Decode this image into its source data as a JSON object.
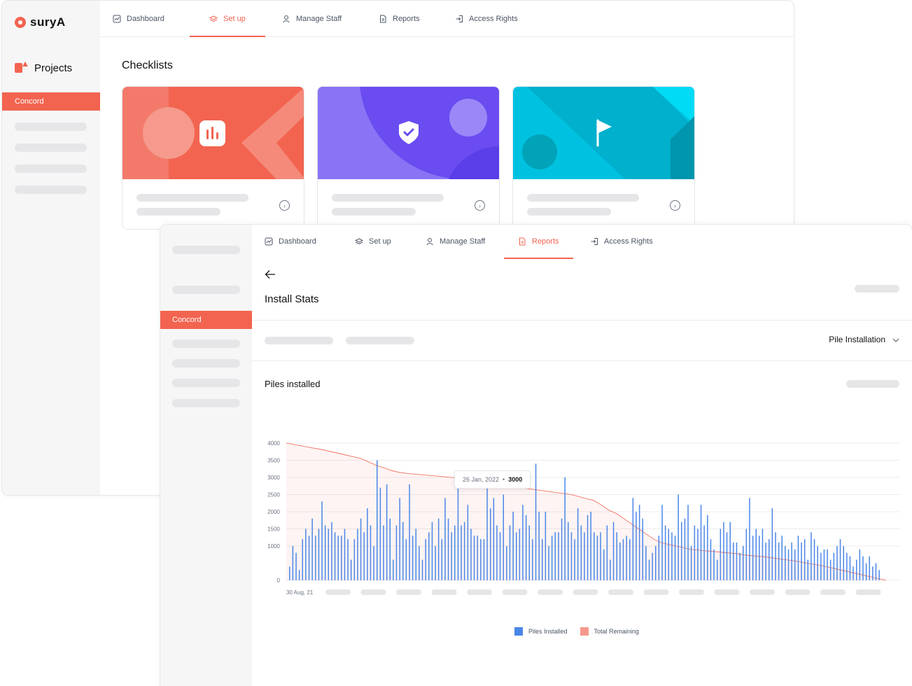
{
  "brand": {
    "name": "suryA"
  },
  "colors": {
    "accent": "#f26450",
    "bar": "#4a86e8",
    "line": "#f26450",
    "card1": "#f26450",
    "card2": "#6a4cf0",
    "card3": "#00c2e0"
  },
  "nav": {
    "items": [
      {
        "label": "Dashboard",
        "icon": "dashboard-icon"
      },
      {
        "label": "Set up",
        "icon": "layers-icon"
      },
      {
        "label": "Manage Staff",
        "icon": "user-icon"
      },
      {
        "label": "Reports",
        "icon": "document-icon"
      },
      {
        "label": "Access Rights",
        "icon": "login-icon"
      }
    ]
  },
  "back_window": {
    "sidebar": {
      "projects_label": "Projects",
      "active_project": "Concord"
    },
    "active_tab": "Set up",
    "section_title": "Checklists",
    "cards": [
      {
        "icon": "bar-chart-icon"
      },
      {
        "icon": "shield-check-icon"
      },
      {
        "icon": "flag-icon"
      }
    ]
  },
  "front_window": {
    "sidebar": {
      "active_project": "Concord"
    },
    "active_tab": "Reports",
    "page_title": "Install Stats",
    "dropdown": {
      "value": "Pile Installation"
    },
    "chart_title": "Piles installed",
    "tooltip": {
      "date": "26 Jan, 2022",
      "value": "3000"
    }
  },
  "chart_data": {
    "type": "bar",
    "title": "Piles installed",
    "xlabel": "",
    "ylabel": "",
    "ylim": [
      0,
      4000
    ],
    "yticks": [
      0,
      1000,
      1500,
      2000,
      2500,
      3000,
      3500,
      4000
    ],
    "x_first_label": "30 Aug, 21",
    "grid": true,
    "legend": "bottom-center",
    "series": [
      {
        "name": "Piles Installed",
        "type": "bar",
        "values": [
          400,
          1000,
          800,
          300,
          1200,
          1500,
          1300,
          1800,
          1300,
          1500,
          2300,
          1600,
          1500,
          1700,
          1400,
          1300,
          1300,
          1500,
          1200,
          600,
          1200,
          1500,
          1800,
          1400,
          2100,
          1600,
          1000,
          3500,
          2700,
          1600,
          2800,
          1800,
          600,
          1600,
          2400,
          1700,
          1200,
          2800,
          1300,
          1500,
          1000,
          600,
          1200,
          1400,
          1700,
          1000,
          1800,
          1200,
          2400,
          1800,
          1400,
          1600,
          2900,
          1600,
          1700,
          2200,
          1500,
          1300,
          1300,
          1200,
          1200,
          2700,
          2100,
          2400,
          1600,
          1400,
          2500,
          1000,
          1600,
          2000,
          1400,
          1500,
          2200,
          1900,
          1600,
          1200,
          3400,
          2000,
          1200,
          2000,
          1000,
          1300,
          1400,
          1400,
          1800,
          3000,
          1700,
          1400,
          1200,
          2100,
          1600,
          1400,
          1900,
          2000,
          1400,
          1300,
          1400,
          900,
          1600,
          600,
          1700,
          1400,
          1100,
          1200,
          1300,
          1200,
          2400,
          2000,
          2200,
          1800,
          1000,
          600,
          800,
          1000,
          1300,
          2200,
          1600,
          1500,
          1400,
          1300,
          2500,
          1700,
          1800,
          2200,
          1000,
          1600,
          1500,
          2200,
          1600,
          1900,
          1200,
          900,
          600,
          1500,
          1700,
          1400,
          1700,
          1100,
          1100,
          800,
          1000,
          1500,
          2400,
          1300,
          1500,
          1300,
          1500,
          1100,
          1200,
          2100,
          1400,
          1100,
          1300,
          1000,
          900,
          1100,
          900,
          1300,
          1100,
          1200,
          600,
          1400,
          1200,
          1000,
          800,
          900,
          900,
          600,
          800,
          1000,
          1200,
          1000,
          800,
          700,
          400,
          600,
          900,
          700,
          500,
          700,
          400,
          500,
          300
        ]
      },
      {
        "name": "Total Remaining",
        "type": "area",
        "values": [
          4000,
          3960,
          3920,
          3880,
          3840,
          3800,
          3750,
          3700,
          3650,
          3600,
          3550,
          3450,
          3350,
          3280,
          3200,
          3150,
          3120,
          3100,
          3080,
          3060,
          3040,
          3020,
          3000,
          2980,
          2950,
          2920,
          2880,
          2840,
          2800,
          2760,
          2720,
          2700,
          2680,
          2650,
          2620,
          2590,
          2560,
          2530,
          2500,
          2440,
          2380,
          2330,
          2200,
          2050,
          1950,
          1800,
          1650,
          1500,
          1350,
          1200,
          1100,
          1050,
          1000,
          950,
          900,
          880,
          860,
          840,
          820,
          800,
          780,
          740,
          720,
          700,
          680,
          650,
          620,
          590,
          560,
          520,
          480,
          440,
          400,
          350,
          300,
          250,
          200,
          150,
          100,
          50,
          0
        ]
      }
    ]
  },
  "legend": {
    "items": [
      {
        "name": "Piles Installed"
      },
      {
        "name": "Total Remaining"
      }
    ]
  }
}
